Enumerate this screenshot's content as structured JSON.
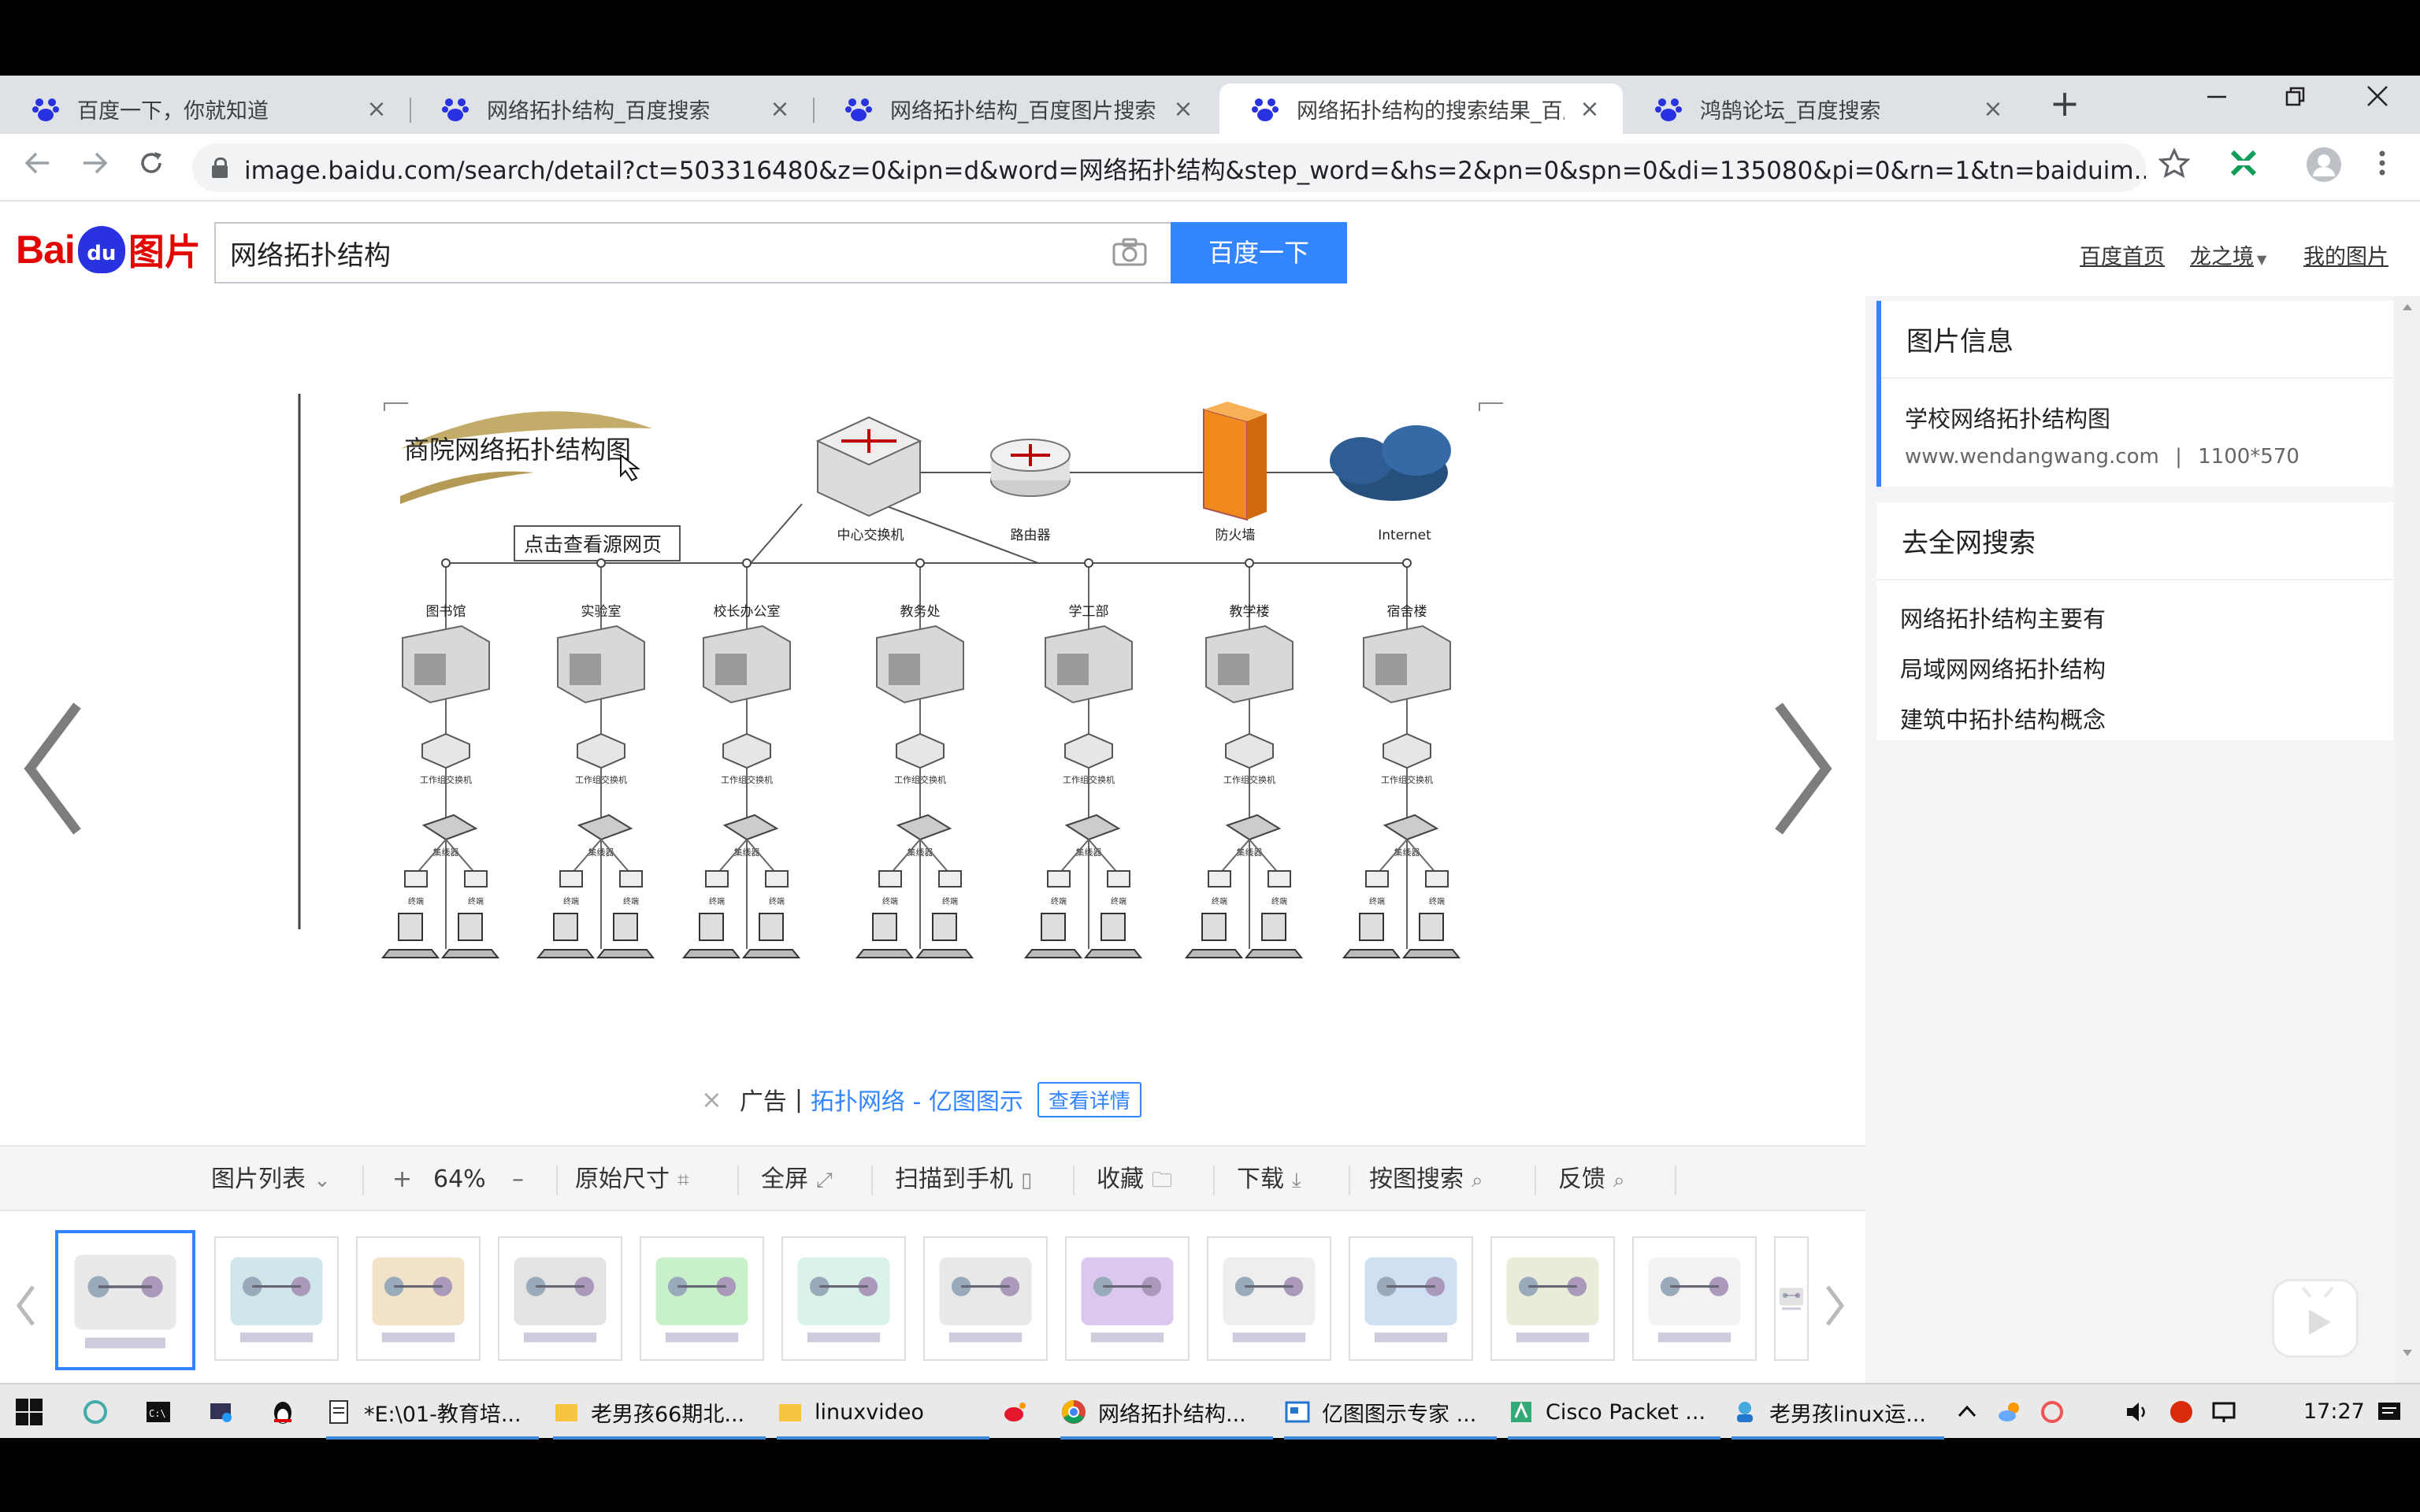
{
  "browser": {
    "tabs": [
      {
        "title": "百度一下，你就知道",
        "active": false
      },
      {
        "title": "网络拓扑结构_百度搜索",
        "active": false
      },
      {
        "title": "网络拓扑结构_百度图片搜索",
        "active": false
      },
      {
        "title": "网络拓扑结构的搜索结果_百度",
        "active": true
      },
      {
        "title": "鸿鹄论坛_百度搜索",
        "active": false
      }
    ],
    "close_glyph": "×",
    "newtab_glyph": "+",
    "url": "image.baidu.com/search/detail?ct=503316480&z=0&ipn=d&word=网络拓扑结构&step_word=&hs=2&pn=0&spn=0&di=135080&pi=0&rn=1&tn=baiduim...",
    "accent": "#3385ff"
  },
  "baidu": {
    "logo_text_a": "Bai",
    "logo_text_b": "du",
    "logo_text_c": "图片",
    "search_value": "网络拓扑结构",
    "search_button": "百度一下",
    "links": [
      "百度首页",
      "龙之境",
      "我的图片"
    ]
  },
  "diagram": {
    "title": "商院网络拓扑结构图",
    "hover_tooltip": "点击查看源网页",
    "core_labels": [
      "中心交换机",
      "路由器",
      "防火墙",
      "Internet"
    ],
    "buildings": [
      "图书馆",
      "实验室",
      "校长办公室",
      "教务处",
      "学工部",
      "教学楼",
      "宿舍楼"
    ],
    "floor_switch_label": "工作组交换机",
    "hub_label": "集线器",
    "pc_label": "终端"
  },
  "ad": {
    "close": "×",
    "label": "广告",
    "separator": "|",
    "link": "拓扑网络 - 亿图图示",
    "detail": "查看详情"
  },
  "image_toolbar": {
    "list": "图片列表",
    "zoom_in": "+",
    "zoom": "64%",
    "zoom_out": "–",
    "original": "原始尺寸",
    "fullscreen": "全屏",
    "scan": "扫描到手机",
    "collect": "收藏",
    "download": "下载",
    "search_by_image": "按图搜索",
    "feedback": "反馈"
  },
  "sidebar": {
    "info_title": "图片信息",
    "image_title": "学校网络拓扑结构图",
    "image_source": "www.wendangwang.com",
    "image_sep": "|",
    "image_size": "1100*570",
    "search_title": "去全网搜索",
    "related": [
      "网络拓扑结构主要有",
      "局域网网络拓扑结构",
      "建筑中拓扑结构概念"
    ]
  },
  "taskbar": {
    "items": [
      "*E:\\01-教育培...",
      "老男孩66期北...",
      "linuxvideo",
      "网络拓扑结构...",
      "亿图图示专家 ...",
      "Cisco Packet ...",
      "老男孩linux运..."
    ],
    "time": "17:27"
  }
}
